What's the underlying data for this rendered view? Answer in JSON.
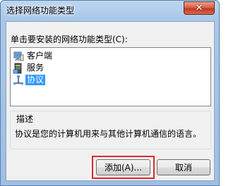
{
  "window": {
    "title": "选择网络功能类型",
    "close_symbol": "✕"
  },
  "dialog": {
    "prompt": "单击要安装的网络功能类型(C):",
    "items": [
      {
        "label": "客户端",
        "icon": "client-computer-icon",
        "selected": false
      },
      {
        "label": "服务",
        "icon": "service-icon",
        "selected": false
      },
      {
        "label": "协议",
        "icon": "protocol-icon",
        "selected": true
      }
    ],
    "description": {
      "title": "描述",
      "text": "协议是您的计算机用来与其他计算机通信的语言。"
    },
    "buttons": {
      "add_label": "添加(A)...",
      "cancel_label": "取消"
    }
  },
  "colors": {
    "selection": "#3399ff",
    "highlight_border": "#e0282a",
    "title_gradient": "#a9c7e8"
  }
}
